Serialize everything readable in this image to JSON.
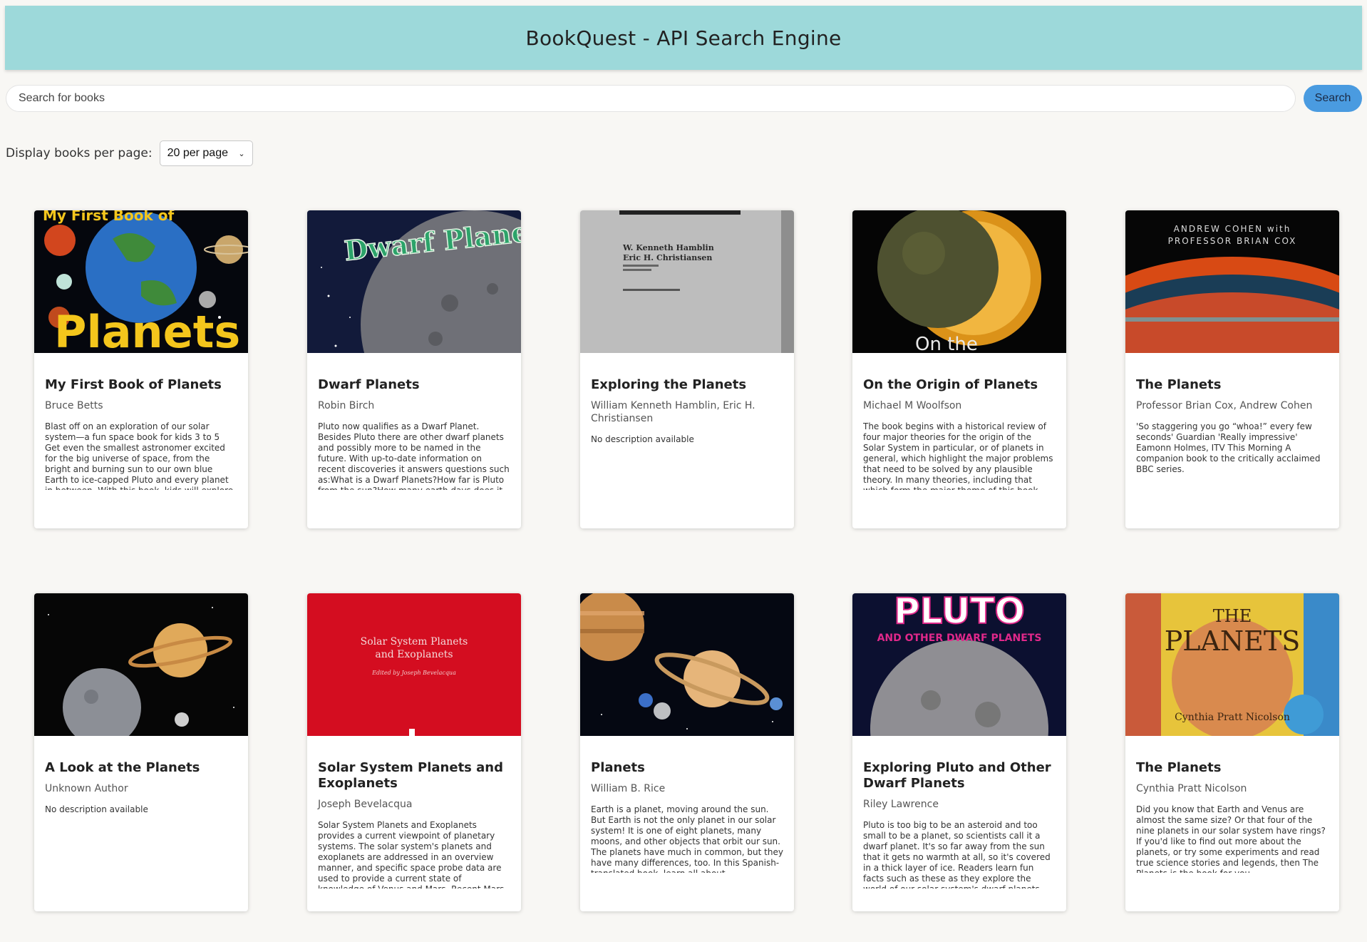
{
  "header": {
    "title": "BookQuest - API Search Engine"
  },
  "search": {
    "placeholder": "Search for books",
    "button_label": "Search"
  },
  "pagination": {
    "label": "Display books per page:",
    "selected": "20 per page"
  },
  "books": [
    {
      "title": "My First Book of Planets",
      "author": "Bruce Betts",
      "description": "Blast off on an exploration of our solar system—a fun space book for kids 3 to 5 Get even the smallest astronomer excited for the big universe of space, from the bright and burning sun to our own blue Earth to ice-capped Pluto and every planet in between. With this book, kids will explore the entire",
      "cover_text": "Planets",
      "cover_top_text": "My First Book of"
    },
    {
      "title": "Dwarf Planets",
      "author": "Robin Birch",
      "description": "Pluto now qualifies as a Dwarf Planet. Besides Pluto there are other dwarf planets and possibly more to be named in the future. With up-to-date information on recent discoveries it answers questions such as:What is a Dwarf Planets?How far is Pluto from the sun?How many earth days does it",
      "cover_text": "Dwarf Planets"
    },
    {
      "title": "Exploring the Planets",
      "author": "William Kenneth Hamblin, Eric H. Christiansen",
      "description": "No description available",
      "cover_text": "W. Kenneth Hamblin",
      "cover_text2": "Eric H. Christiansen"
    },
    {
      "title": "On the Origin of Planets",
      "author": "Michael M Woolfson",
      "description": "The book begins with a historical review of four major theories for the origin of the Solar System in particular, or of planets in general, which highlight the major problems that need to be solved by any plausible theory. In many theories, including that which form the major theme of this book, the formation",
      "cover_text": "On the"
    },
    {
      "title": "The Planets",
      "author": "Professor Brian Cox, Andrew Cohen",
      "description": "'So staggering you go “whoa!” every few seconds' Guardian 'Really impressive' Eamonn Holmes, ITV This Morning A companion book to the critically acclaimed BBC series.",
      "cover_text": "ANDREW COHEN with",
      "cover_text2": "PROFESSOR BRIAN COX"
    },
    {
      "title": "A Look at the Planets",
      "author": "Unknown Author",
      "description": "No description available"
    },
    {
      "title": "Solar System Planets and Exoplanets",
      "author": "Joseph Bevelacqua",
      "description": "Solar System Planets and Exoplanets provides a current viewpoint of planetary systems. The solar system's planets and exoplanets are addressed in an overview manner, and specific space probe data are used to provide a current state of knowledge of Venus and Mars. Recent Mars data and",
      "cover_text": "Solar System Planets",
      "cover_text2": "and Exoplanets",
      "cover_text3": "Edited by Joseph Bevelacqua"
    },
    {
      "title": "Planets",
      "author": "William B. Rice",
      "description": "Earth is a planet, moving around the sun. But Earth is not the only planet in our solar system! It is one of eight planets, many moons, and other objects that orbit our sun. The planets have much in common, but they have many differences, too. In this Spanish-translated book, learn all about"
    },
    {
      "title": "Exploring Pluto and Other Dwarf Planets",
      "author": "Riley Lawrence",
      "description": "Pluto is too big to be an asteroid and too small to be a planet, so scientists call it a dwarf planet. It's so far away from the sun that it gets no warmth at all, so it's covered in a thick layer of ice. Readers learn fun facts such as these as they explore the world of our solar system's dwarf planets. Informative",
      "cover_text": "PLUTO",
      "cover_text2": "AND OTHER DWARF PLANETS"
    },
    {
      "title": "The Planets",
      "author": "Cynthia Pratt Nicolson",
      "description": "Did you know that Earth and Venus are almost the same size? Or that four of the nine planets in our solar system have rings? If you'd like to find out more about the planets, or try some experiments and read true science stories and legends, then The Planets is the book for you.",
      "cover_text": "THE",
      "cover_text2": "PLANETS",
      "cover_text3": "Cynthia Pratt Nicolson"
    }
  ]
}
